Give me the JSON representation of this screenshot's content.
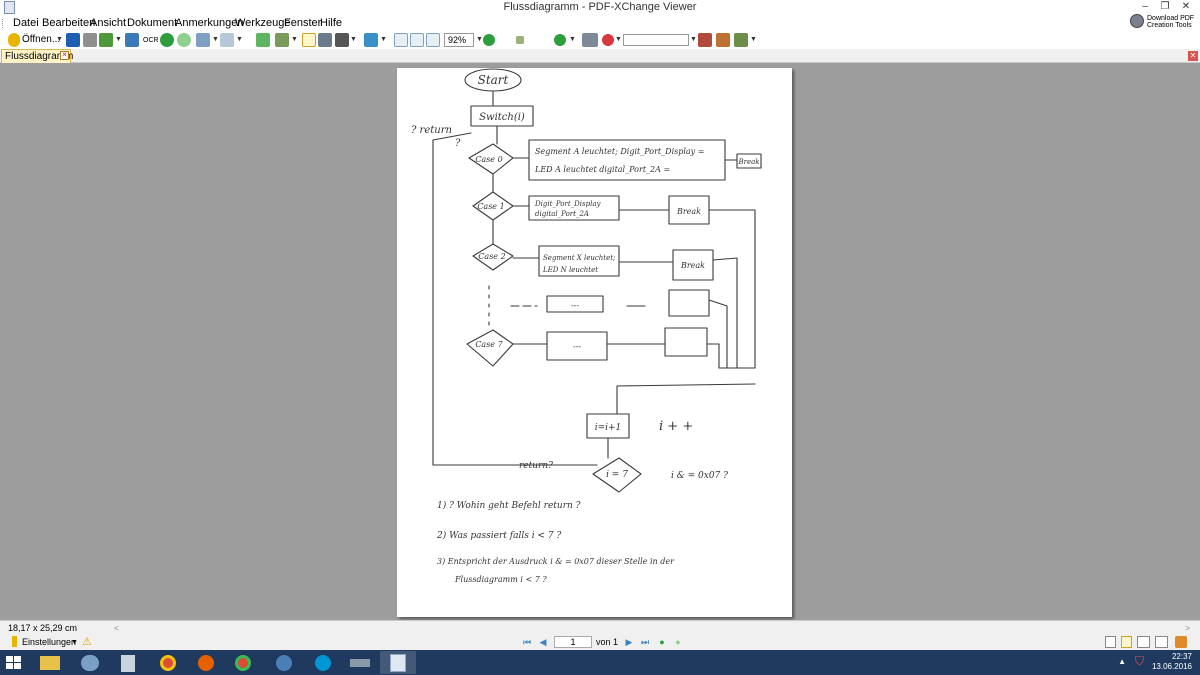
{
  "window": {
    "title": "Flussdiagramm - PDF-XChange Viewer",
    "download_line1": "Download PDF",
    "download_line2": "Creation Tools"
  },
  "menu": [
    "Datei",
    "Bearbeiten",
    "Ansicht",
    "Dokument",
    "Anmerkungen",
    "Werkzeuge",
    "Fenster",
    "Hilfe"
  ],
  "toolbar": {
    "open_label": "Öffnen...",
    "ocr_label": "OCR",
    "zoom": "92%",
    "search_value": ""
  },
  "tab": {
    "label": "Flussdiagramm"
  },
  "status": {
    "page_dims": "18,17 x 25,29 cm",
    "settings_label": "Einstellungen",
    "current_page": "1",
    "page_of": "von 1"
  },
  "taskbar": {
    "time": "22:37",
    "date": "13.06.2016"
  },
  "diagram": {
    "start": "Start",
    "switch": "Switch(i)",
    "return_q": "? return",
    "q_mark": "?",
    "case0": "Case 0",
    "case0_line1": "Segment A leuchtet;  Digit_Port_Display =",
    "case0_line2": "LED A leuchtet      digital_Port_2A =",
    "break": "Break",
    "case1": "Case 1",
    "case1_line1": "Digit_Port_Display",
    "case1_line2": "digital_Port_2A",
    "case2": "Case 2",
    "case2_line1": "Segment X leuchtet;",
    "case2_line2": "LED N leuchtet",
    "dashes": "---",
    "case7": "Case 7",
    "increment": "i=i+1",
    "iplusplus": "i + +",
    "return_q2": "return?",
    "cond": "i = 7",
    "cond_question": "i & = 0x07 ?",
    "note1": "1)  ? Wohin geht Befehl  return ?",
    "note2": "2)  Was passiert falls  i < 7 ?",
    "note3a": "3)  Entspricht der Ausdruck  i & = 0x07  dieser Stelle in der",
    "note3b": "Flussdiagramm   i < 7 ?"
  }
}
